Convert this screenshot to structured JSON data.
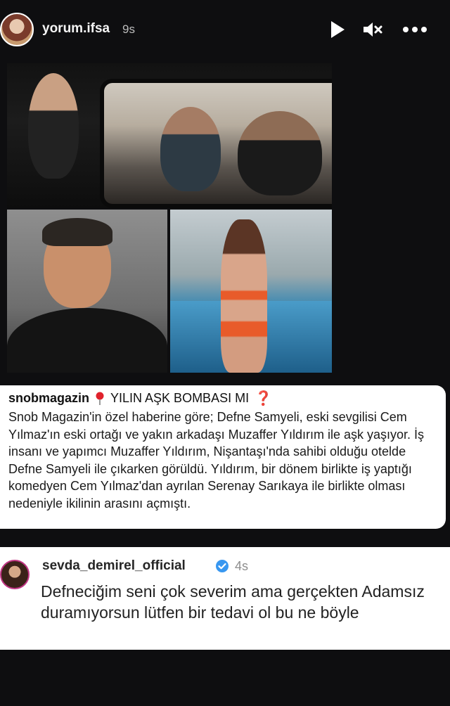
{
  "header": {
    "username": "yorum.ifsa",
    "time": "9s",
    "icons": [
      "avatar",
      "play-icon",
      "mute-icon",
      "more-icon"
    ]
  },
  "caption": {
    "handle": "snobmagazin",
    "headline": "YILIN AŞK BOMBASI MI",
    "pin_icon": "round-pushpin",
    "question_icon": "red-question-mark",
    "body": "Snob Magazin'in özel haberine göre; Defne Samyeli, eski sevgilisi Cem Yılmaz'ın eski ortağı ve yakın arkadaşı Muzaffer Yıldırım ile aşk yaşıyor. İş insanı ve yapımcı Muzaffer Yıldırım, Nişantaşı'nda sahibi olduğu otelde Defne Samyeli ile çıkarken görüldü. Yıldırım, bir dönem birlikte iş yaptığı komedyen Cem Yılmaz'dan ayrılan Serenay Sarıkaya ile birlikte olması nedeniyle ikilinin arasını açmıştı."
  },
  "comment": {
    "username": "sevda_demirel_official",
    "time": "4s",
    "verified": true,
    "text": "Defneciğim seni çok severim ama gerçekten Adamsız duramıyorsun lütfen bir tedavi ol bu ne böyle"
  },
  "colors": {
    "background": "#0e0e10",
    "accent_red": "#e0222c",
    "verified_blue": "#3897f0"
  }
}
